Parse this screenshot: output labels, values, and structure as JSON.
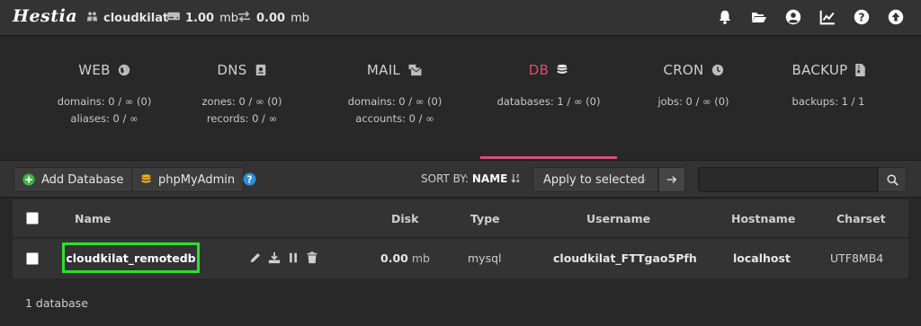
{
  "header": {
    "logo_text": "Hestia",
    "user": "cloudkilat",
    "disk_value": "1.00",
    "disk_unit": "mb",
    "bandwidth_value": "0.00",
    "bandwidth_unit": "mb",
    "icons": [
      "bell-icon",
      "folder-open-icon",
      "user-circle-icon",
      "chart-line-icon",
      "question-circle-icon",
      "arrow-up-circle-icon"
    ]
  },
  "stats": [
    {
      "title": "WEB",
      "icon": "globe-icon",
      "line1": "domains: 0 / ∞ (0)",
      "line2": "aliases: 0 / ∞"
    },
    {
      "title": "DNS",
      "icon": "book-icon",
      "line1": "zones: 0 / ∞ (0)",
      "line2": "records: 0 / ∞"
    },
    {
      "title": "MAIL",
      "icon": "mail-bulk-icon",
      "line1": "domains: 0 / ∞ (0)",
      "line2": "accounts: 0 / ∞"
    },
    {
      "title": "DB",
      "icon": "database-icon",
      "line1": "databases: 1 / ∞ (0)",
      "line2": ""
    },
    {
      "title": "CRON",
      "icon": "clock-icon",
      "line1": "jobs: 0 / ∞ (0)",
      "line2": ""
    },
    {
      "title": "BACKUP",
      "icon": "file-archive-icon",
      "line1": "backups: 1 / 1",
      "line2": ""
    }
  ],
  "toolbar": {
    "add_label": "Add Database",
    "phpmyadmin_label": "phpMyAdmin",
    "sort_prefix": "SORT BY:",
    "sort_value": "NAME",
    "apply_select": "Apply to selected",
    "search_placeholder": ""
  },
  "table": {
    "headers": {
      "name": "Name",
      "disk": "Disk",
      "type": "Type",
      "username": "Username",
      "hostname": "Hostname",
      "charset": "Charset"
    },
    "rows": [
      {
        "name": "cloudkilat_remotedb",
        "disk_value": "0.00",
        "disk_unit": "mb",
        "type": "mysql",
        "username": "cloudkilat_FTTgao5Pfh",
        "hostname": "localhost",
        "charset": "UTF8MB4"
      }
    ]
  },
  "footer": {
    "count": "1 database"
  },
  "colors": {
    "accent": "#dc4d74",
    "highlight": "#2de02d",
    "add_green": "#3bb54a",
    "info_blue": "#2f8fd8",
    "db_yellow": "#f2b01e"
  }
}
